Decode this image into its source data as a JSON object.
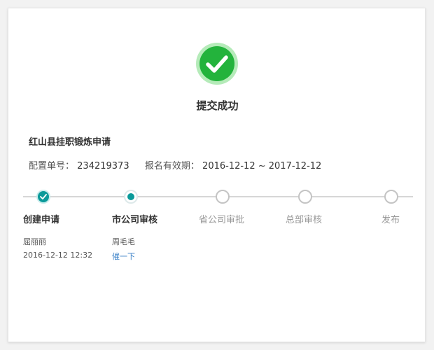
{
  "result": {
    "title": "提交成功",
    "icon": "check-circle-icon",
    "color": "#23b33c"
  },
  "application": {
    "title": "红山县挂职锻炼申请",
    "config_no_label": "配置单号：",
    "config_no": "234219373",
    "validity_label": "报名有效期：",
    "validity": "2016-12-12 ~ 2017-12-12"
  },
  "steps": [
    {
      "label": "创建申请",
      "state": "done",
      "person": "屈丽丽",
      "time": "2016-12-12 12:32"
    },
    {
      "label": "市公司审核",
      "state": "current",
      "person": "周毛毛",
      "action": "催一下"
    },
    {
      "label": "省公司审批",
      "state": "pending"
    },
    {
      "label": "总部审核",
      "state": "pending"
    },
    {
      "label": "发布",
      "state": "pending"
    }
  ],
  "colors": {
    "accent": "#0a9a9a",
    "link": "#3c82c8",
    "pending": "#c4c4c4"
  }
}
